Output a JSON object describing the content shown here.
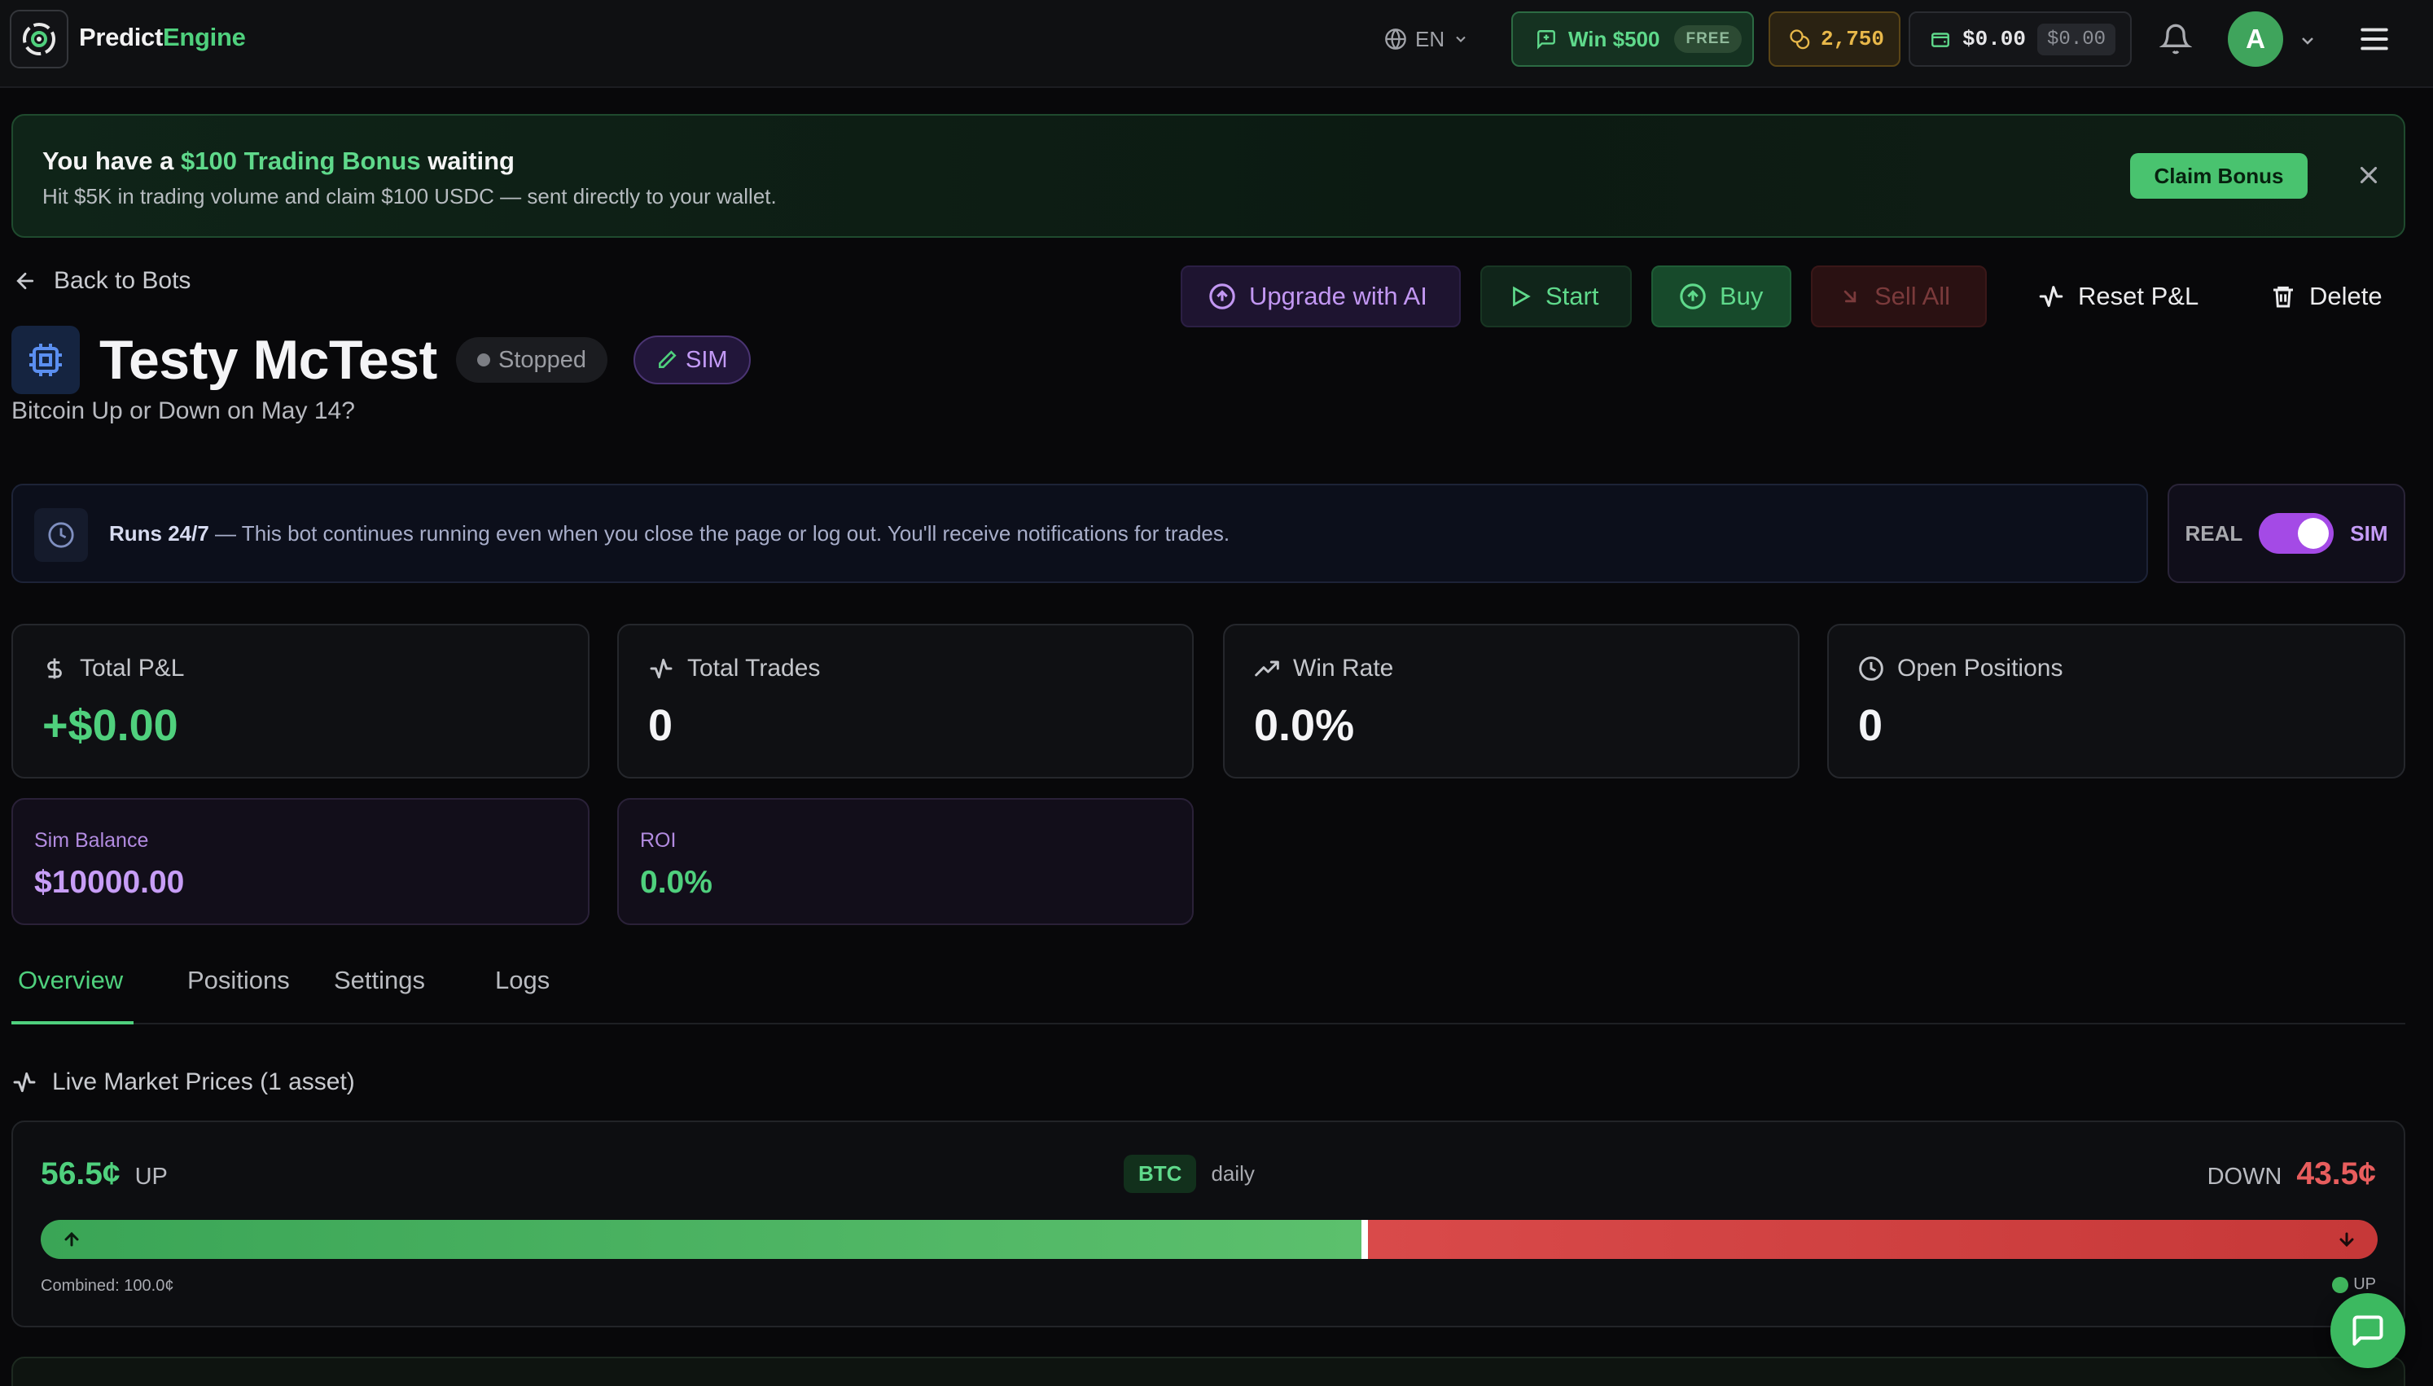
{
  "header": {
    "brand_part1": "Predict",
    "brand_part2": "Engine",
    "language": "EN",
    "win_label": "Win $500",
    "free_badge": "FREE",
    "coins": "2,750",
    "wallet_balance": "$0.00",
    "wallet_secondary": "$0.00",
    "avatar_initial": "A"
  },
  "banner": {
    "title_prefix": "You have a ",
    "title_highlight": "$100 Trading Bonus",
    "title_suffix": " waiting",
    "subtitle": "Hit $5K in trading volume and claim $100 USDC — sent directly to your wallet.",
    "claim_label": "Claim Bonus"
  },
  "nav": {
    "back_label": "Back to Bots"
  },
  "actions": {
    "upgrade": "Upgrade with AI",
    "start": "Start",
    "buy": "Buy",
    "sell_all": "Sell All",
    "reset": "Reset P&L",
    "delete": "Delete"
  },
  "bot": {
    "name": "Testy McTest",
    "status": "Stopped",
    "mode_badge": "SIM",
    "market": "Bitcoin Up or Down on May 14?"
  },
  "runs": {
    "bold": "Runs 24/7",
    "text": " — This bot continues running even when you close the page or log out. You'll receive notifications for trades."
  },
  "mode_toggle": {
    "real_label": "REAL",
    "sim_label": "SIM",
    "selected": "SIM"
  },
  "stats": {
    "total_pnl_label": "Total P&L",
    "total_pnl_value": "+$0.00",
    "total_trades_label": "Total Trades",
    "total_trades_value": "0",
    "win_rate_label": "Win Rate",
    "win_rate_value": "0.0%",
    "open_positions_label": "Open Positions",
    "open_positions_value": "0",
    "sim_balance_label": "Sim Balance",
    "sim_balance_value": "$10000.00",
    "roi_label": "ROI",
    "roi_value": "0.0%"
  },
  "tabs": [
    {
      "label": "Overview",
      "active": true
    },
    {
      "label": "Positions",
      "active": false
    },
    {
      "label": "Settings",
      "active": false
    },
    {
      "label": "Logs",
      "active": false
    }
  ],
  "live_market": {
    "heading": "Live Market Prices (1 asset)",
    "up_price": "56.5¢",
    "up_label": "UP",
    "asset": "BTC",
    "period": "daily",
    "down_label": "DOWN",
    "down_price": "43.5¢",
    "up_share": 0.565,
    "combined": "Combined: 100.0¢",
    "legend": "UP"
  },
  "colors": {
    "accent_green": "#4fd07d",
    "sim_purple": "#c39af6",
    "down_red": "#e85d5d"
  }
}
